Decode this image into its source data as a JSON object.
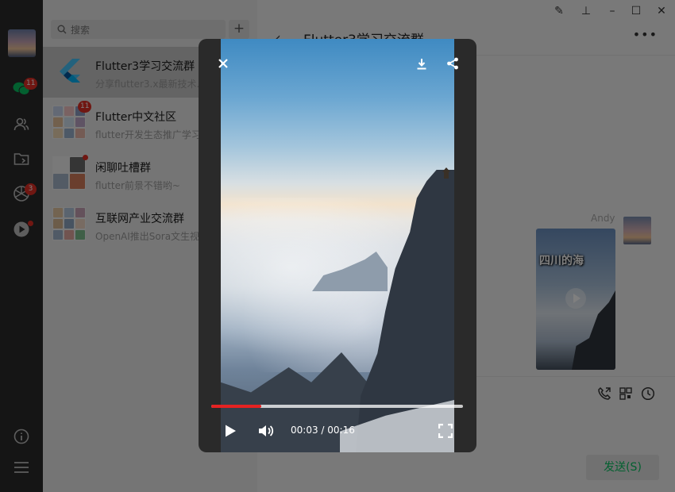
{
  "rail": {
    "chat_badge": "11",
    "moments_badge": "3"
  },
  "search": {
    "placeholder": "搜索",
    "add_label": "+"
  },
  "chats": [
    {
      "name": "Flutter3学习交流群",
      "preview": "分享flutter3.x最新技术..."
    },
    {
      "name": "Flutter中文社区",
      "preview": "flutter开发生态推广学习",
      "badge": "11"
    },
    {
      "name": "闲聊吐槽群",
      "preview": "flutter前景不错哟~"
    },
    {
      "name": "互联网产业交流群",
      "preview": "OpenAI推出Sora文生视"
    }
  ],
  "chat": {
    "title": "Flutter3学习交流群",
    "sender": "Andy",
    "video_caption": "四川的海",
    "send_label": "发送(S)"
  },
  "player": {
    "current_time": "00:03",
    "separator": " / ",
    "duration": "00:16",
    "progress": 0.2
  },
  "colors": {
    "accent_red": "#e52222",
    "send_green": "#07c160",
    "rail_bg": "#2b2b2b"
  },
  "icons": [
    "magic-wand-icon",
    "pin-icon",
    "minimize-icon",
    "maximize-icon",
    "close-icon",
    "chat-icon",
    "contacts-icon",
    "folder-icon",
    "moments-icon",
    "video-icon",
    "info-icon",
    "menu-icon",
    "search-icon",
    "back-icon",
    "more-icon",
    "download-icon",
    "share-icon",
    "play-icon",
    "volume-icon",
    "fullscreen-icon",
    "call-icon",
    "qrcode-icon",
    "history-icon"
  ]
}
